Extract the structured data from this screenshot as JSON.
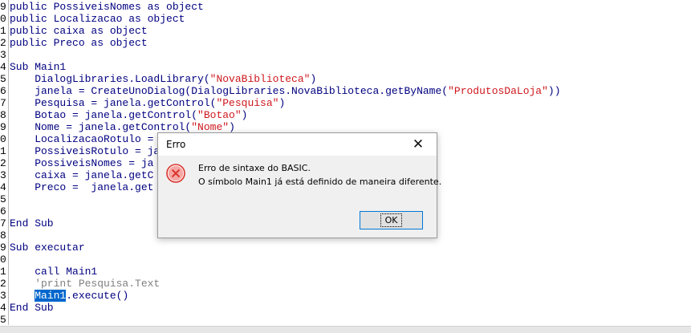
{
  "editor": {
    "lines": [
      {
        "ln": "9",
        "parts": [
          {
            "t": "public ",
            "c": "kw"
          },
          {
            "t": "PossiveisNomes",
            "c": "kw"
          },
          {
            "t": " as object",
            "c": "kw"
          }
        ]
      },
      {
        "ln": "0",
        "parts": [
          {
            "t": "public Localizacao as object",
            "c": "kw"
          }
        ]
      },
      {
        "ln": "1",
        "parts": [
          {
            "t": "public caixa as object",
            "c": "kw"
          }
        ]
      },
      {
        "ln": "2",
        "parts": [
          {
            "t": "public Preco as object",
            "c": "kw"
          }
        ]
      },
      {
        "ln": "3",
        "parts": []
      },
      {
        "ln": "4",
        "parts": [
          {
            "t": "Sub Main1",
            "c": "kw"
          }
        ]
      },
      {
        "ln": "5",
        "parts": [
          {
            "t": "    DialogLibraries.LoadLibrary(",
            "c": "kw"
          },
          {
            "t": "\"NovaBiblioteca\"",
            "c": "str"
          },
          {
            "t": ")",
            "c": "kw"
          }
        ]
      },
      {
        "ln": "6",
        "parts": [
          {
            "t": "    janela = CreateUnoDialog(DialogLibraries.NovaBiblioteca.getByName(",
            "c": "kw"
          },
          {
            "t": "\"ProdutosDaLoja\"",
            "c": "str"
          },
          {
            "t": "))",
            "c": "kw"
          }
        ]
      },
      {
        "ln": "7",
        "parts": [
          {
            "t": "    Pesquisa = janela.getControl(",
            "c": "kw"
          },
          {
            "t": "\"Pesquisa\"",
            "c": "str"
          },
          {
            "t": ")",
            "c": "kw"
          }
        ]
      },
      {
        "ln": "8",
        "parts": [
          {
            "t": "    Botao = janela.getControl(",
            "c": "kw"
          },
          {
            "t": "\"Botao\"",
            "c": "str"
          },
          {
            "t": ")",
            "c": "kw"
          }
        ]
      },
      {
        "ln": "9",
        "parts": [
          {
            "t": "    Nome = janela.getControl(",
            "c": "kw"
          },
          {
            "t": "\"Nome\"",
            "c": "str"
          },
          {
            "t": ")",
            "c": "kw"
          }
        ]
      },
      {
        "ln": "0",
        "parts": [
          {
            "t": "    LocalizacaoRotulo = ",
            "c": "kw"
          }
        ]
      },
      {
        "ln": "1",
        "parts": [
          {
            "t": "    PossiveisRotulo = ja",
            "c": "kw"
          }
        ]
      },
      {
        "ln": "2",
        "parts": [
          {
            "t": "    PossiveisNomes = ja",
            "c": "kw"
          }
        ]
      },
      {
        "ln": "3",
        "parts": [
          {
            "t": "    caixa = janela.getC",
            "c": "kw"
          }
        ]
      },
      {
        "ln": "4",
        "parts": [
          {
            "t": "    Preco =  janela.get",
            "c": "kw"
          }
        ]
      },
      {
        "ln": "5",
        "parts": []
      },
      {
        "ln": "6",
        "parts": []
      },
      {
        "ln": "7",
        "parts": [
          {
            "t": "End Sub",
            "c": "kw"
          }
        ]
      },
      {
        "ln": "8",
        "parts": []
      },
      {
        "ln": "9",
        "parts": [
          {
            "t": "Sub executar",
            "c": "kw"
          }
        ]
      },
      {
        "ln": "0",
        "parts": []
      },
      {
        "ln": "1",
        "parts": [
          {
            "t": "    call Main1",
            "c": "kw"
          }
        ]
      },
      {
        "ln": "2",
        "parts": [
          {
            "t": "    'print Pesquisa.Text",
            "c": "cm"
          }
        ]
      },
      {
        "ln": "3",
        "parts": [
          {
            "t": "    ",
            "c": "kw"
          },
          {
            "t": "Main1",
            "c": "sel"
          },
          {
            "t": ".execute()",
            "c": "kw"
          }
        ]
      },
      {
        "ln": "4",
        "parts": [
          {
            "t": "End Sub",
            "c": "kw"
          }
        ]
      },
      {
        "ln": "5",
        "parts": []
      }
    ]
  },
  "dialog": {
    "title": "Erro",
    "close_glyph": "✕",
    "icon": "error-icon",
    "message_line1": "Erro de sintaxe do BASIC.",
    "message_line2": "O símbolo Main1 já está definido de maneira diferente.",
    "ok_label": "OK"
  }
}
